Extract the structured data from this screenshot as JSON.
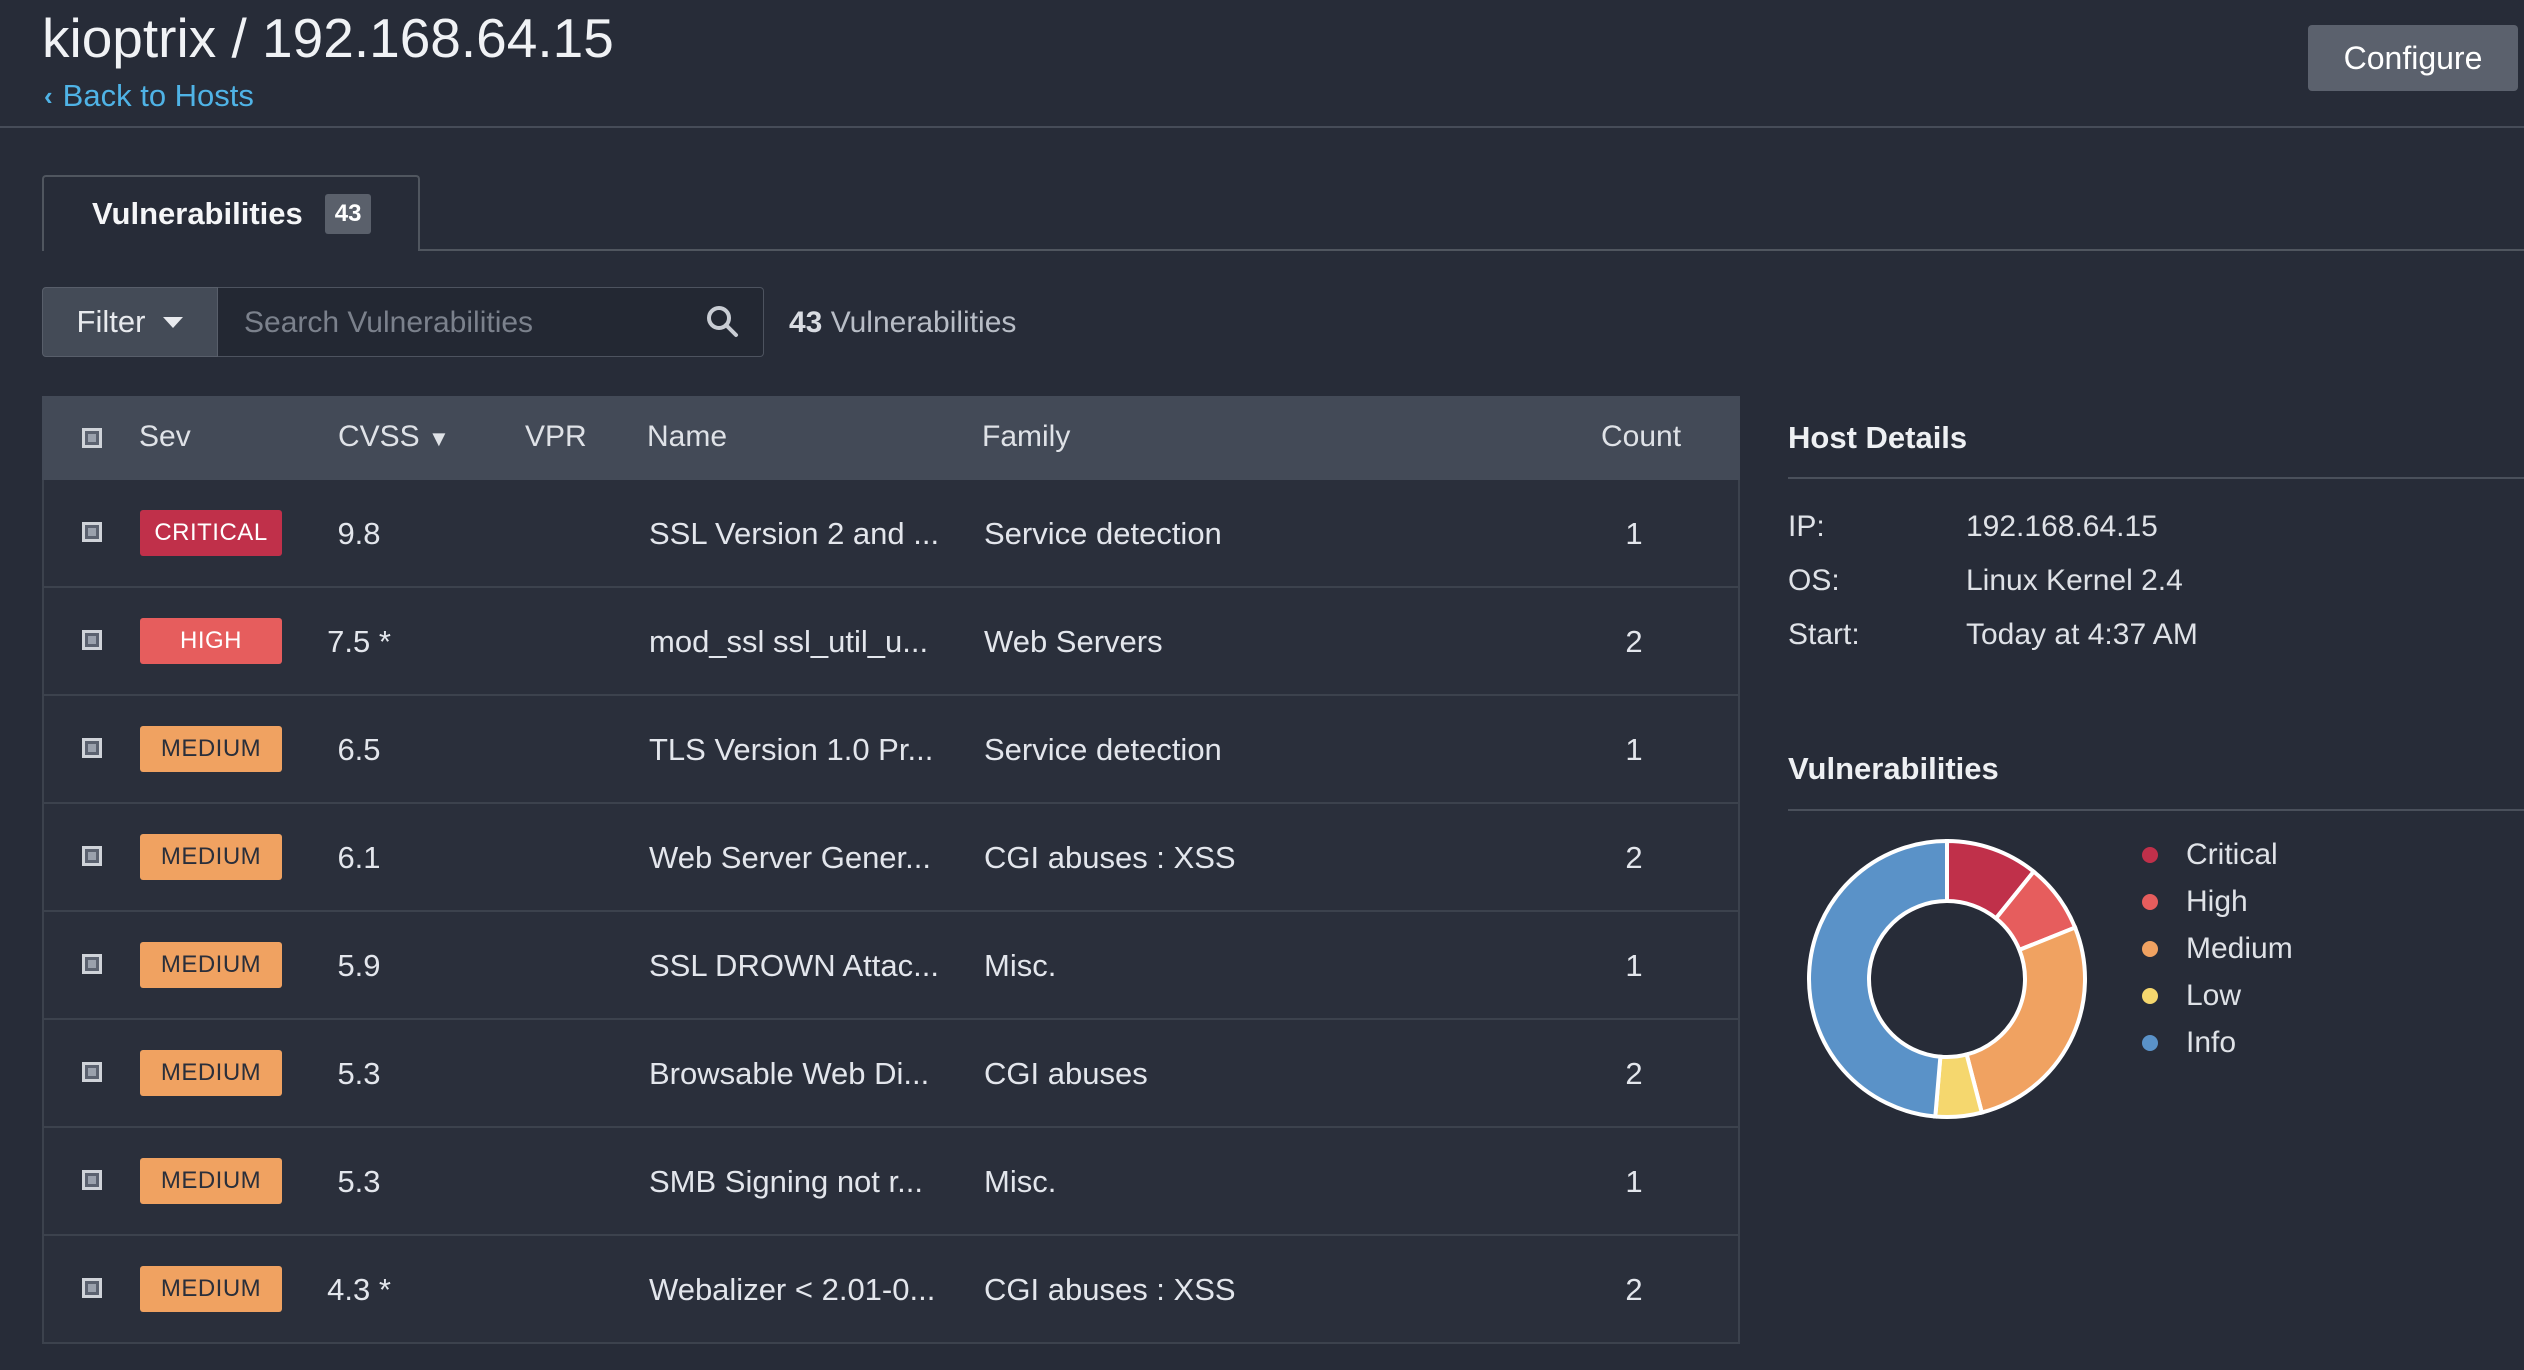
{
  "header": {
    "title": "kioptrix / 192.168.64.15",
    "back_label": "Back to Hosts",
    "configure_label": "Configure"
  },
  "tabs": [
    {
      "label": "Vulnerabilities",
      "badge": "43"
    }
  ],
  "toolbar": {
    "filter_label": "Filter",
    "search_placeholder": "Search Vulnerabilities",
    "count_number": "43",
    "count_suffix": "Vulnerabilities"
  },
  "table": {
    "columns": [
      "Sev",
      "CVSS",
      "VPR",
      "Name",
      "Family",
      "Count"
    ],
    "sort_indicator": "▼",
    "rows": [
      {
        "sev": "CRITICAL",
        "cvss": "9.8",
        "vpr": "",
        "name": "SSL Version 2 and ...",
        "family": "Service detection",
        "count": "1"
      },
      {
        "sev": "HIGH",
        "cvss": "7.5 *",
        "vpr": "",
        "name": "mod_ssl ssl_util_u...",
        "family": "Web Servers",
        "count": "2"
      },
      {
        "sev": "MEDIUM",
        "cvss": "6.5",
        "vpr": "",
        "name": "TLS Version 1.0 Pr...",
        "family": "Service detection",
        "count": "1"
      },
      {
        "sev": "MEDIUM",
        "cvss": "6.1",
        "vpr": "",
        "name": "Web Server Gener...",
        "family": "CGI abuses : XSS",
        "count": "2"
      },
      {
        "sev": "MEDIUM",
        "cvss": "5.9",
        "vpr": "",
        "name": "SSL DROWN Attac...",
        "family": "Misc.",
        "count": "1"
      },
      {
        "sev": "MEDIUM",
        "cvss": "5.3",
        "vpr": "",
        "name": "Browsable Web Di...",
        "family": "CGI abuses",
        "count": "2"
      },
      {
        "sev": "MEDIUM",
        "cvss": "5.3",
        "vpr": "",
        "name": "SMB Signing not r...",
        "family": "Misc.",
        "count": "1"
      },
      {
        "sev": "MEDIUM",
        "cvss": "4.3 *",
        "vpr": "",
        "name": "Webalizer < 2.01-0...",
        "family": "CGI abuses : XSS",
        "count": "2"
      }
    ]
  },
  "host_details": {
    "title": "Host Details",
    "ip_label": "IP:",
    "ip_value": "192.168.64.15",
    "os_label": "OS:",
    "os_value": "Linux Kernel 2.4",
    "start_label": "Start:",
    "start_value": "Today at 4:37 AM"
  },
  "vuln_chart": {
    "title": "Vulnerabilities"
  },
  "severity_colors": {
    "CRITICAL": {
      "bg": "#c0304a",
      "fg": "#ffffff"
    },
    "HIGH": {
      "bg": "#e65d5d",
      "fg": "#ffffff"
    },
    "MEDIUM": {
      "bg": "#f0a261",
      "fg": "#2a2f3b"
    }
  },
  "chart_data": {
    "type": "pie",
    "donut": true,
    "categories": [
      "Critical",
      "High",
      "Medium",
      "Low",
      "Info"
    ],
    "values": [
      4,
      3,
      10,
      2,
      18
    ],
    "colors": [
      "#c0304a",
      "#e65d5d",
      "#f0a261",
      "#f5d76e",
      "#5a92c8"
    ],
    "legend_position": "right"
  }
}
